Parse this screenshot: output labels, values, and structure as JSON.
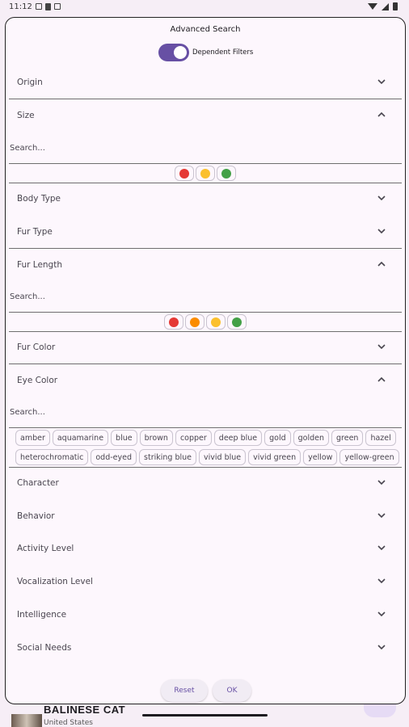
{
  "status_bar": {
    "time": "11:12"
  },
  "dialog": {
    "title": "Advanced Search",
    "dependent_filters_label": "Dependent Filters",
    "dependent_filters_on": true,
    "search_placeholder": "Search...",
    "sections": {
      "origin": "Origin",
      "size": "Size",
      "body_type": "Body Type",
      "fur_type": "Fur Type",
      "fur_length": "Fur Length",
      "fur_color": "Fur Color",
      "eye_color": "Eye Color",
      "character": "Character",
      "behavior": "Behavior",
      "activity_level": "Activity Level",
      "vocalization_level": "Vocalization Level",
      "intelligence": "Intelligence",
      "social_needs": "Social Needs"
    },
    "size_levels": [
      "#e53935",
      "#fbc02d",
      "#43a047"
    ],
    "fur_length_levels": [
      "#e53935",
      "#fb8c00",
      "#fbc02d",
      "#43a047"
    ],
    "eye_colors_row1": [
      "amber",
      "aquamarine",
      "blue",
      "brown",
      "copper",
      "deep blue",
      "gold",
      "golden",
      "green",
      "hazel"
    ],
    "eye_colors_row2": [
      "heterochromatic",
      "odd-eyed",
      "striking blue",
      "vivid blue",
      "vivid green",
      "yellow",
      "yellow-green"
    ],
    "reset_label": "Reset",
    "ok_label": "OK",
    "accent": "#6750a4"
  },
  "background": {
    "title": "BALINESE CAT",
    "subtitle": "United States"
  }
}
